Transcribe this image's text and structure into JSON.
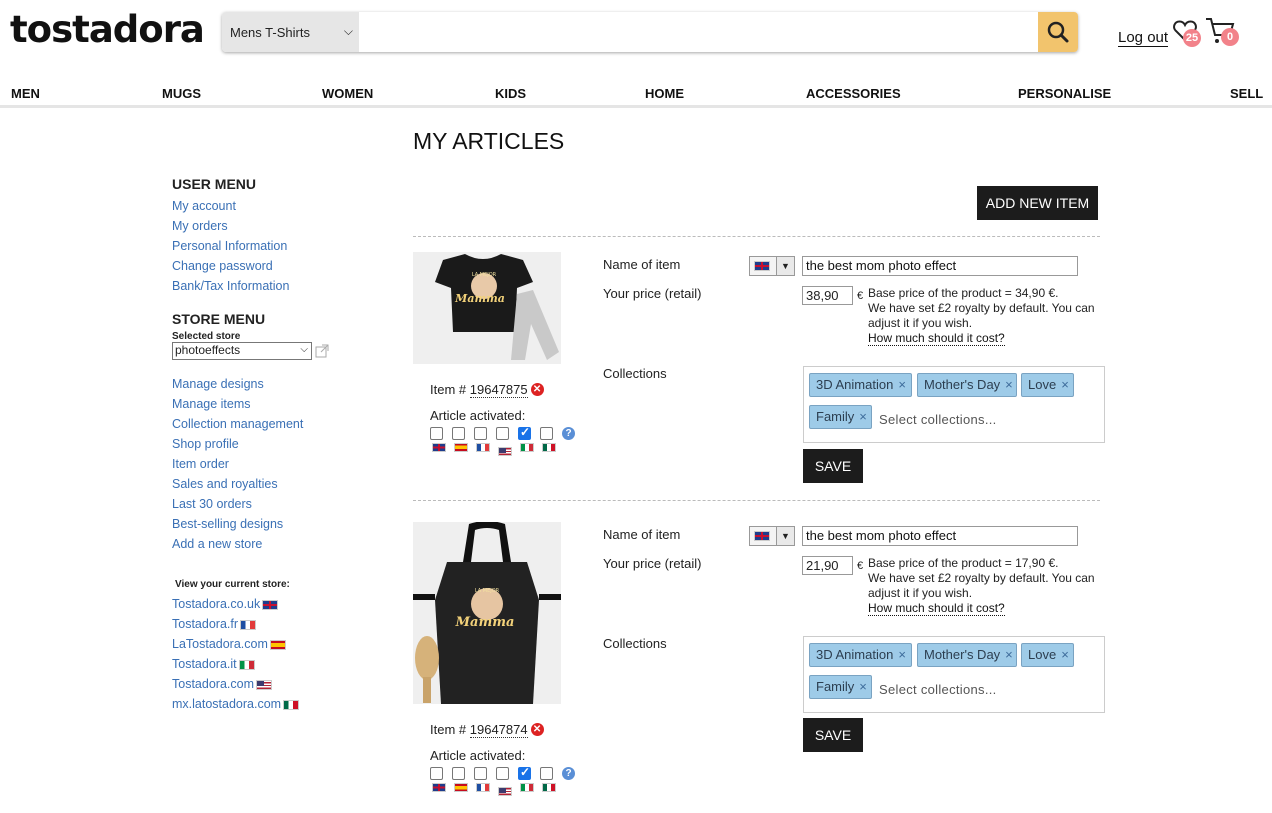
{
  "header": {
    "logo": "tostadora",
    "search_category": "Mens T-Shirts",
    "search_placeholder": "",
    "logout": "Log out",
    "wishlist_count": "25",
    "cart_count": "0"
  },
  "nav": [
    "MEN",
    "MUGS",
    "WOMEN",
    "KIDS",
    "HOME",
    "ACCESSORIES",
    "PERSONALISE",
    "SELL"
  ],
  "page_title": "MY ARTICLES",
  "add_new_item": "ADD NEW ITEM",
  "sidebar": {
    "user_menu_title": "USER MENU",
    "user_menu": [
      "My account",
      "My orders",
      "Personal Information",
      "Change password",
      "Bank/Tax Information"
    ],
    "store_menu_title": "STORE MENU",
    "selected_store_label": "Selected store",
    "selected_store": "photoeffects",
    "store_menu": [
      "Manage designs",
      "Manage items",
      "Collection management",
      "Shop profile",
      "Item order",
      "Sales and royalties",
      "Last 30 orders",
      "Best-selling designs",
      "Add a new store"
    ],
    "view_store_label": "View your current store:",
    "stores": [
      "Tostadora.co.uk",
      "Tostadora.fr",
      "LaTostadora.com",
      "Tostadora.it",
      "Tostadora.com",
      "mx.latostadora.com"
    ]
  },
  "labels": {
    "item_prefix": "Item # ",
    "article_activated": "Article activated:",
    "name_of_item": "Name of item",
    "your_price": "Your price (retail)",
    "collections": "Collections",
    "euro": "€",
    "royalty_note": "We have set £2 royalty by default. You can adjust it if you wish.",
    "how_much": "How much should it cost?",
    "collections_placeholder": "Select collections...",
    "save": "SAVE",
    "logo_text": "LA MEJOR",
    "logo_word": "Mamma"
  },
  "items": [
    {
      "number": "19647875",
      "name": "the best mom photo effect",
      "price": "38,90",
      "base_price": "Base price of the product = 34,90 €.",
      "collections": [
        "3D Animation",
        "Mother's Day",
        "Love",
        "Family"
      ],
      "activated": [
        false,
        false,
        false,
        false,
        true,
        false
      ]
    },
    {
      "number": "19647874",
      "name": "the best mom photo effect",
      "price": "21,90",
      "base_price": "Base price of the product = 17,90 €.",
      "collections": [
        "3D Animation",
        "Mother's Day",
        "Love",
        "Family"
      ],
      "activated": [
        false,
        false,
        false,
        false,
        true,
        false
      ]
    }
  ],
  "icons": {
    "search": "search-icon",
    "wishlist": "heart-icon",
    "cart": "cart-icon",
    "delete": "delete-icon",
    "help": "help-icon",
    "external": "external-link-icon"
  },
  "colors": {
    "accent": "#f2c46d",
    "link": "#3a70b5",
    "tag_bg": "#9ecbe8",
    "badge": "#f2828a",
    "button": "#1c1c1c"
  }
}
